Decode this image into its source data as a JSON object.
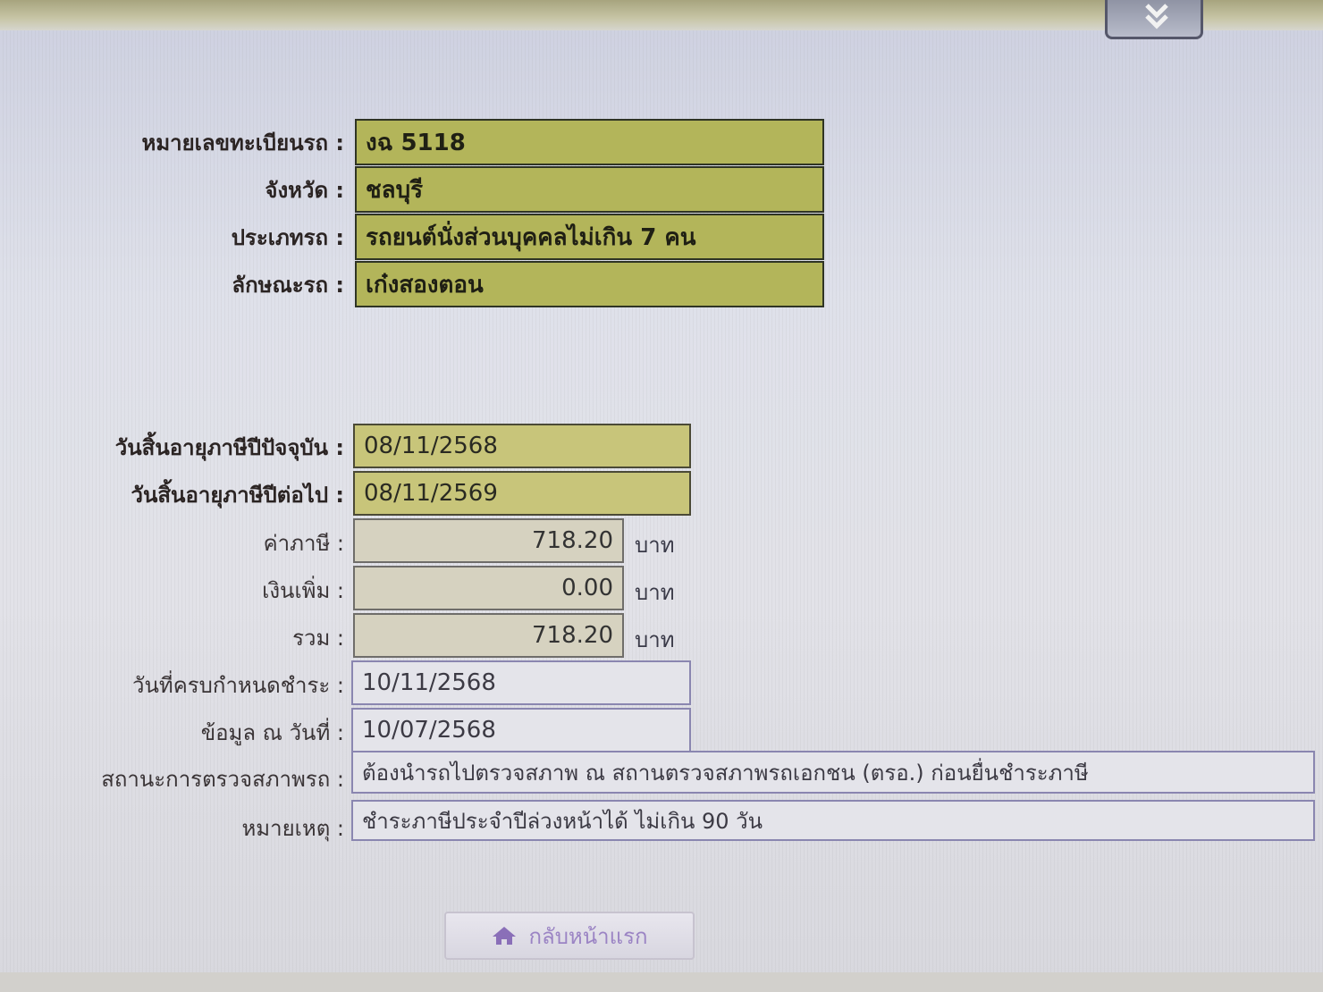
{
  "vehicle": {
    "plate": {
      "label": "หมายเลขทะเบียนรถ :",
      "value": "งฉ 5118"
    },
    "province": {
      "label": "จังหวัด :",
      "value": "ชลบุรี"
    },
    "type": {
      "label": "ประเภทรถ :",
      "value": "รถยนต์นั่งส่วนบุคคลไม่เกิน 7 คน"
    },
    "body": {
      "label": "ลักษณะรถ :",
      "value": "เก๋งสองตอน"
    }
  },
  "tax": {
    "current_expiry": {
      "label": "วันสิ้นอายุภาษีปีปัจจุบัน :",
      "value": "08/11/2568"
    },
    "next_expiry": {
      "label": "วันสิ้นอายุภาษีปีต่อไป :",
      "value": "08/11/2569"
    },
    "tax_amount": {
      "label": "ค่าภาษี :",
      "value": "718.20",
      "unit": "บาท"
    },
    "surcharge": {
      "label": "เงินเพิ่ม :",
      "value": "0.00",
      "unit": "บาท"
    },
    "total": {
      "label": "รวม :",
      "value": "718.20",
      "unit": "บาท"
    },
    "due_date": {
      "label": "วันที่ครบกำหนดชำระ :",
      "value": "10/11/2568"
    },
    "data_date": {
      "label": "ข้อมูล ณ วันที่ :",
      "value": "10/07/2568"
    },
    "inspection_status": {
      "label": "สถานะการตรวจสภาพรถ :",
      "value": "ต้องนำรถไปตรวจสภาพ ณ สถานตรวจสภาพรถเอกชน (ตรอ.) ก่อนยื่นชำระภาษี"
    },
    "remark": {
      "label": "หมายเหตุ :",
      "value": "ชำระภาษีประจำปีล่วงหน้าได้ ไม่เกิน 90 วัน"
    }
  },
  "home_button": {
    "label": "กลับหน้าแรก",
    "icon": "home-icon"
  },
  "top_button": {
    "icon": "download-arrow-icon"
  },
  "colors": {
    "olive_field": "#b3b55a",
    "khaki_field": "#c8c57a",
    "button_text": "#9b84c4"
  }
}
